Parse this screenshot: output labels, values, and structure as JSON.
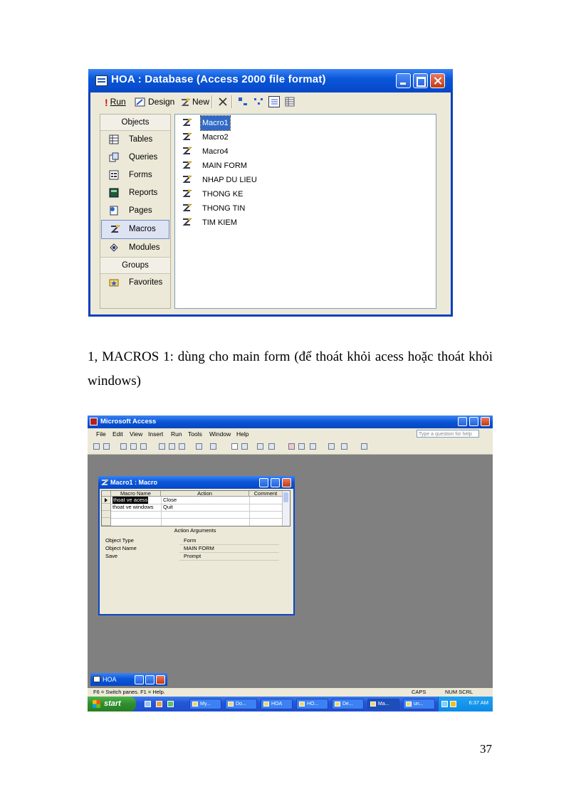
{
  "db_window": {
    "title": "HOA : Database (Access 2000 file format)",
    "toolbar": {
      "run": "Run",
      "design": "Design",
      "new": "New"
    },
    "sidebar": {
      "objects_header": "Objects",
      "items": [
        {
          "label": "Tables",
          "icon": "table-icon"
        },
        {
          "label": "Queries",
          "icon": "query-icon"
        },
        {
          "label": "Forms",
          "icon": "form-icon"
        },
        {
          "label": "Reports",
          "icon": "report-icon"
        },
        {
          "label": "Pages",
          "icon": "page-icon"
        },
        {
          "label": "Macros",
          "icon": "macro-icon",
          "selected": true
        },
        {
          "label": "Modules",
          "icon": "module-icon"
        }
      ],
      "groups_header": "Groups",
      "favorites": "Favorites"
    },
    "macros": [
      "Macro1",
      "Macro2",
      "Macro4",
      "MAIN FORM",
      "NHAP DU LIEU",
      "THONG KE",
      "THONG TIN",
      "TIM KIEM"
    ],
    "selected_macro": "Macro1"
  },
  "caption": "1, MACROS 1: dùng cho main form (để thoát khỏi acess hoặc thoát khỏi windows)",
  "access_app": {
    "title": "Microsoft Access",
    "menus": [
      "File",
      "Edit",
      "View",
      "Insert",
      "Run",
      "Tools",
      "Window",
      "Help"
    ],
    "ask_placeholder": "Type a question for help",
    "macro_window": {
      "title": "Macro1 : Macro",
      "columns": [
        "Macro Name",
        "Action",
        "Comment"
      ],
      "rows": [
        {
          "name": "thoat ve acess",
          "action": "Close"
        },
        {
          "name": "thoat ve windows",
          "action": "Quit"
        }
      ],
      "action_arguments_header": "Action Arguments",
      "arguments": [
        {
          "label": "Object Type",
          "value": "Form"
        },
        {
          "label": "Object Name",
          "value": "MAIN FORM"
        },
        {
          "label": "Save",
          "value": "Prompt"
        }
      ]
    },
    "minimized_window": "HOA",
    "status_left": "F6 = Switch panes.  F1 = Help.",
    "status_caps": "CAPS",
    "status_num": "NUM  SCRL",
    "taskbar": {
      "start": "start",
      "tasks": [
        "My...",
        "Do...",
        "HOA",
        "HO...",
        "De...",
        "Ma...",
        "un..."
      ],
      "clock": "6:37 AM"
    }
  },
  "page_number": "37"
}
